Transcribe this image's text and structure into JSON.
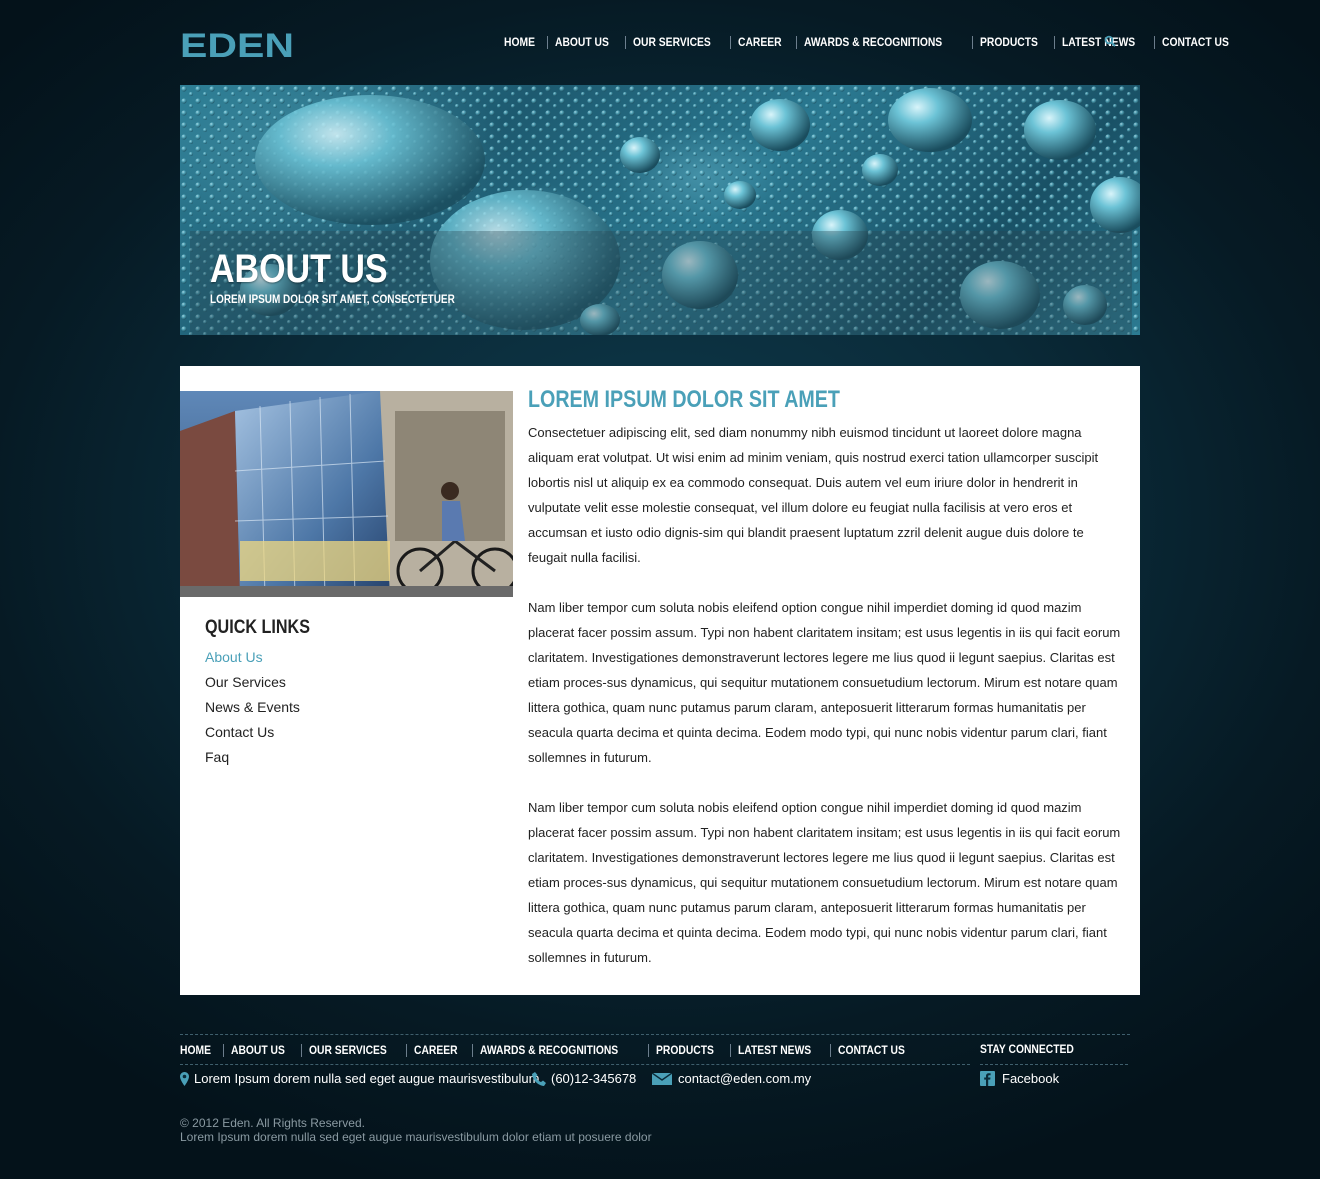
{
  "header": {
    "logo_text": "EDEN",
    "nav": [
      "HOME",
      "ABOUT US",
      "OUR SERVICES",
      "CAREER",
      "AWARDS & RECOGNITIONS",
      "PRODUCTS",
      "LATEST NEWS",
      "CONTACT US"
    ],
    "search_icon": "search-icon"
  },
  "banner": {
    "title": "ABOUT US",
    "subtitle": "LOREM IPSUM DOLOR SIT AMET, CONSECTETUER"
  },
  "sidebar": {
    "quick_links_title": "QUICK LINKS",
    "links": [
      "About Us",
      "Our Services",
      "News & Events",
      "Contact Us",
      "Faq"
    ],
    "active_link": "About Us"
  },
  "content": {
    "heading": "LOREM IPSUM DOLOR SIT AMET",
    "paragraphs": [
      "Consectetuer adipiscing elit, sed diam nonummy nibh euismod tincidunt ut laoreet dolore magna aliquam erat volutpat. Ut wisi enim ad minim veniam, quis nostrud exerci tation ullamcorper suscipit lobortis nisl ut aliquip ex ea commodo consequat. Duis autem vel eum iriure dolor in hendrerit in vulputate velit esse molestie consequat, vel illum dolore eu feugiat nulla facilisis at vero eros et accumsan et iusto odio dignis-sim qui blandit praesent luptatum zzril delenit augue duis dolore te feugait nulla facilisi.",
      "Nam liber tempor cum soluta nobis eleifend option congue nihil imperdiet doming id quod mazim placerat facer possim assum. Typi non habent claritatem insitam; est usus legentis in iis qui facit eorum claritatem. Investigationes demonstraverunt lectores legere me lius quod ii legunt saepius. Claritas est etiam proces-sus dynamicus, qui sequitur mutationem consuetudium lectorum. Mirum est notare quam littera gothica, quam nunc putamus parum claram, anteposuerit litterarum formas humanitatis per seacula quarta decima et quinta decima. Eodem modo typi, qui nunc nobis videntur parum clari, fiant sollemnes in futurum.",
      "Nam liber tempor cum soluta nobis eleifend option congue nihil imperdiet doming id quod mazim placerat facer possim assum. Typi non habent claritatem insitam; est usus legentis in iis qui facit eorum claritatem. Investigationes demonstraverunt lectores legere me lius quod ii legunt saepius. Claritas est etiam proces-sus dynamicus, qui sequitur mutationem consuetudium lectorum. Mirum est notare quam littera gothica, quam nunc putamus parum claram, anteposuerit litterarum formas humanitatis per seacula quarta decima et quinta decima. Eodem modo typi, qui nunc nobis videntur parum clari, fiant sollemnes in futurum."
    ]
  },
  "footer": {
    "nav": [
      "HOME",
      "ABOUT US",
      "OUR SERVICES",
      "CAREER",
      "AWARDS & RECOGNITIONS",
      "PRODUCTS",
      "LATEST NEWS",
      "CONTACT US"
    ],
    "stay_connected": "STAY CONNECTED",
    "address": "Lorem Ipsum dorem nulla sed eget augue maurisvestibulum",
    "phone": "(60)12-345678",
    "email": "contact@eden.com.my",
    "facebook": "Facebook",
    "copyright": "© 2012 Eden. All Rights Reserved.",
    "tagline": "Lorem Ipsum dorem nulla sed eget augue maurisvestibulum dolor etiam ut posuere dolor"
  },
  "colors": {
    "accent": "#4aa0b8",
    "background": "#0a2a38",
    "panel": "#ffffff"
  }
}
